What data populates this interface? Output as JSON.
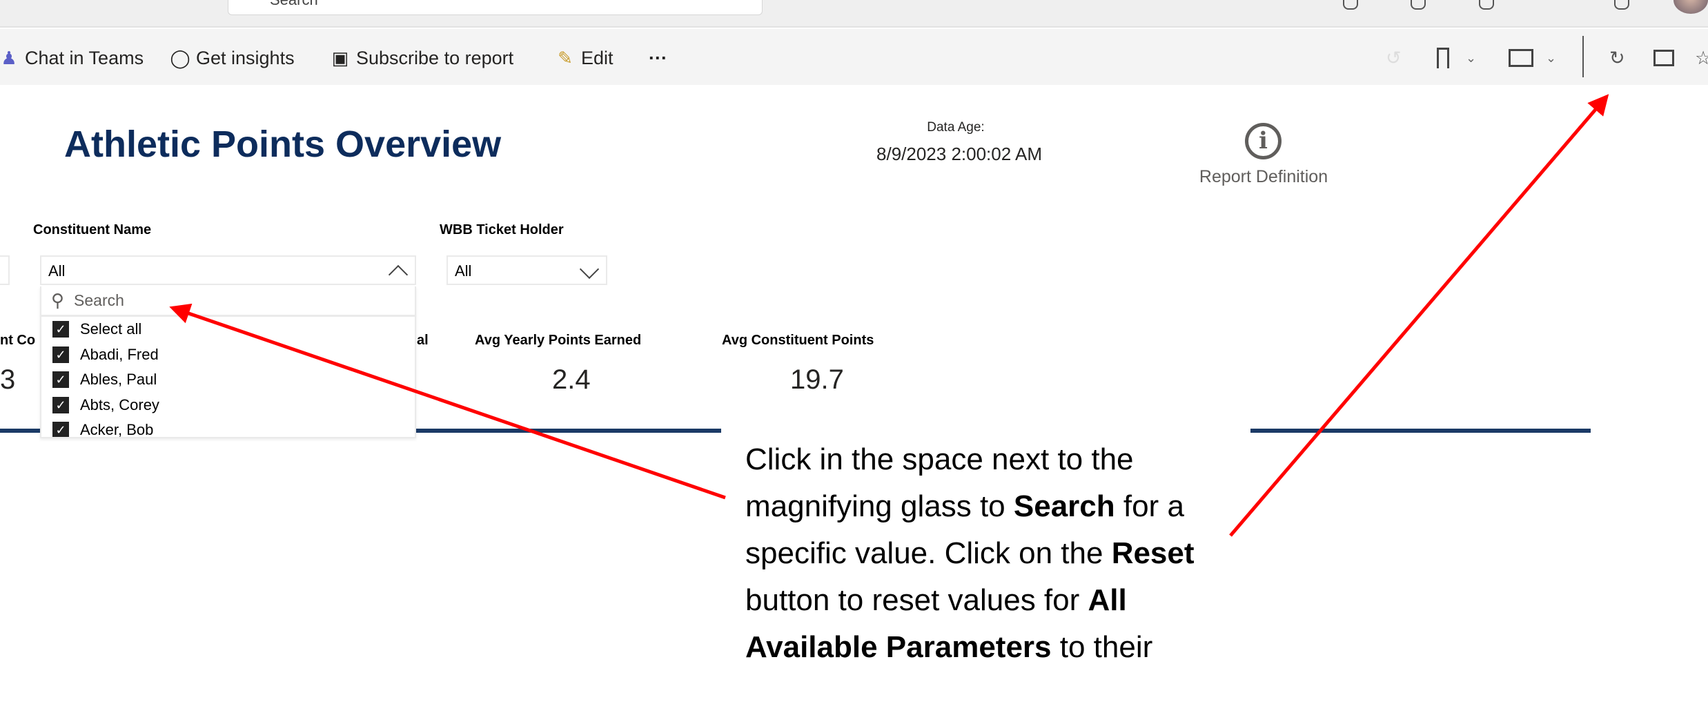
{
  "browser": {
    "search_placeholder": "Search",
    "top_icons": [
      "extensions-icon",
      "settings-icon",
      "download-icon",
      "help-icon"
    ]
  },
  "toolbar": {
    "items": [
      {
        "label": "Chat in Teams",
        "icon": "teams-icon"
      },
      {
        "label": "Get insights",
        "icon": "lightbulb-icon"
      },
      {
        "label": "Subscribe to report",
        "icon": "subscribe-icon"
      },
      {
        "label": "Edit",
        "icon": "pencil-icon"
      }
    ],
    "more": "···",
    "right_icons": [
      "undo-icon",
      "bookmark-icon",
      "view-icon",
      "refresh-icon",
      "comment-icon",
      "favorite-icon"
    ]
  },
  "report": {
    "title": "Athletic Points Overview",
    "data_age_label": "Data Age:",
    "data_age_value": "8/9/2023 2:00:02 AM",
    "report_definition": "Report Definition",
    "info_glyph": "i"
  },
  "slicers": {
    "constituent": {
      "label": "Constituent Name",
      "value": "All",
      "search_placeholder": "Search",
      "items": [
        "Select all",
        "Abadi, Fred",
        "Ables, Paul",
        "Abts, Corey",
        "Acker, Bob"
      ]
    },
    "wbb": {
      "label": "WBB Ticket Holder",
      "value": "All"
    }
  },
  "cards": [
    {
      "label": "nt Co",
      "value": "3"
    },
    {
      "label": "al",
      "value": ""
    },
    {
      "label": "Avg Yearly Points Earned",
      "value": "2.4"
    },
    {
      "label": "Avg Constituent Points",
      "value": "19.7"
    }
  ],
  "callout": {
    "p1": "Click in the space next to the magnifying glass to ",
    "b1": "Search",
    "p2": " for a specific value. Click on the ",
    "b2": "Reset",
    "p3": " button to reset values for ",
    "b3": "All Available Parameters",
    "p4": " to their"
  },
  "colors": {
    "title": "#0d2c5c",
    "arrow": "#ff0000",
    "rule": "#1b3a66"
  }
}
